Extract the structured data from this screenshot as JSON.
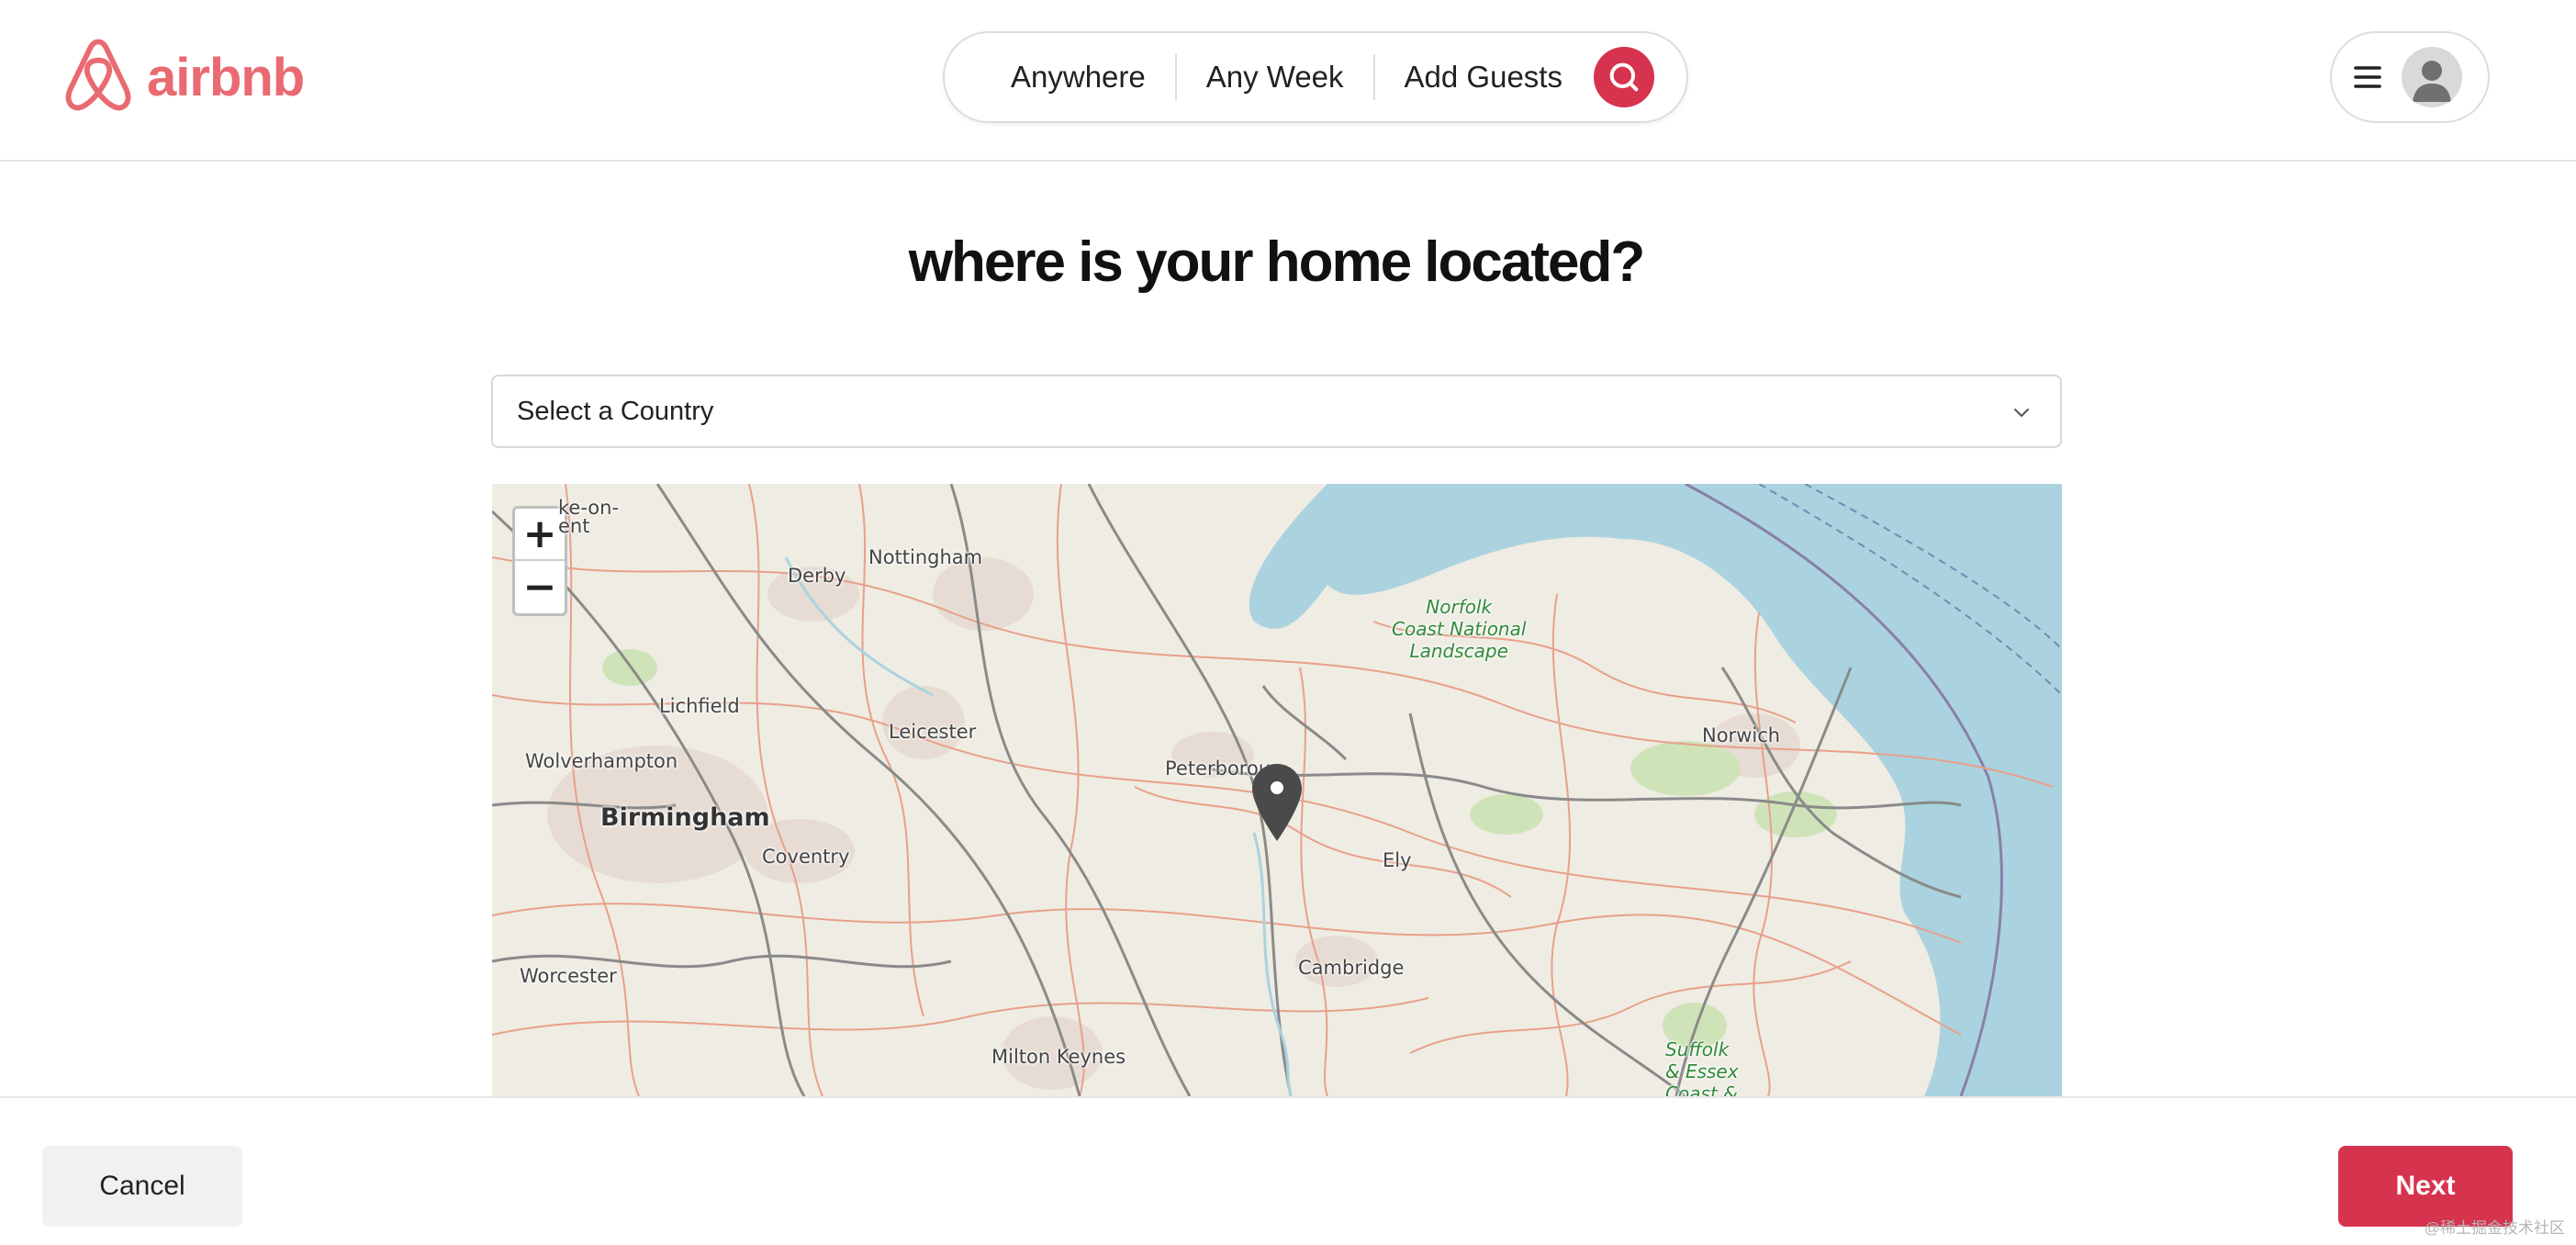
{
  "brand": {
    "name": "airbnb",
    "color": "#e96a71"
  },
  "header": {
    "search_pill": {
      "where_label": "Anywhere",
      "when_label": "Any Week",
      "guests_label": "Add Guests"
    }
  },
  "main": {
    "title": "where is your home located?",
    "country_select": {
      "selected": "Select a Country"
    },
    "map": {
      "zoom_in": "+",
      "zoom_out": "−",
      "labels": {
        "stoke": "ke-on-\nent",
        "derby": "Derby",
        "nottingham": "Nottingham",
        "lichfield": "Lichfield",
        "leicester": "Leicester",
        "wolverhampton": "Wolverhampton",
        "birmingham": "Birmingham",
        "coventry": "Coventry",
        "peterborough": "Peterborou",
        "ely": "Ely",
        "cambridge": "Cambridge",
        "worcester": "Worcester",
        "milton_keynes": "Milton Keynes",
        "norwich": "Norwich",
        "norfolk_coast": "Norfolk\nCoast National\nLandscape",
        "suffolk": "Suffolk\n& Essex\nCoast &"
      }
    }
  },
  "footer": {
    "cancel_label": "Cancel",
    "next_label": "Next",
    "watermark": "@稀土掘金技术社区"
  },
  "colors": {
    "accent": "#d6334f",
    "sea": "#aad3df",
    "land": "#efece3"
  }
}
